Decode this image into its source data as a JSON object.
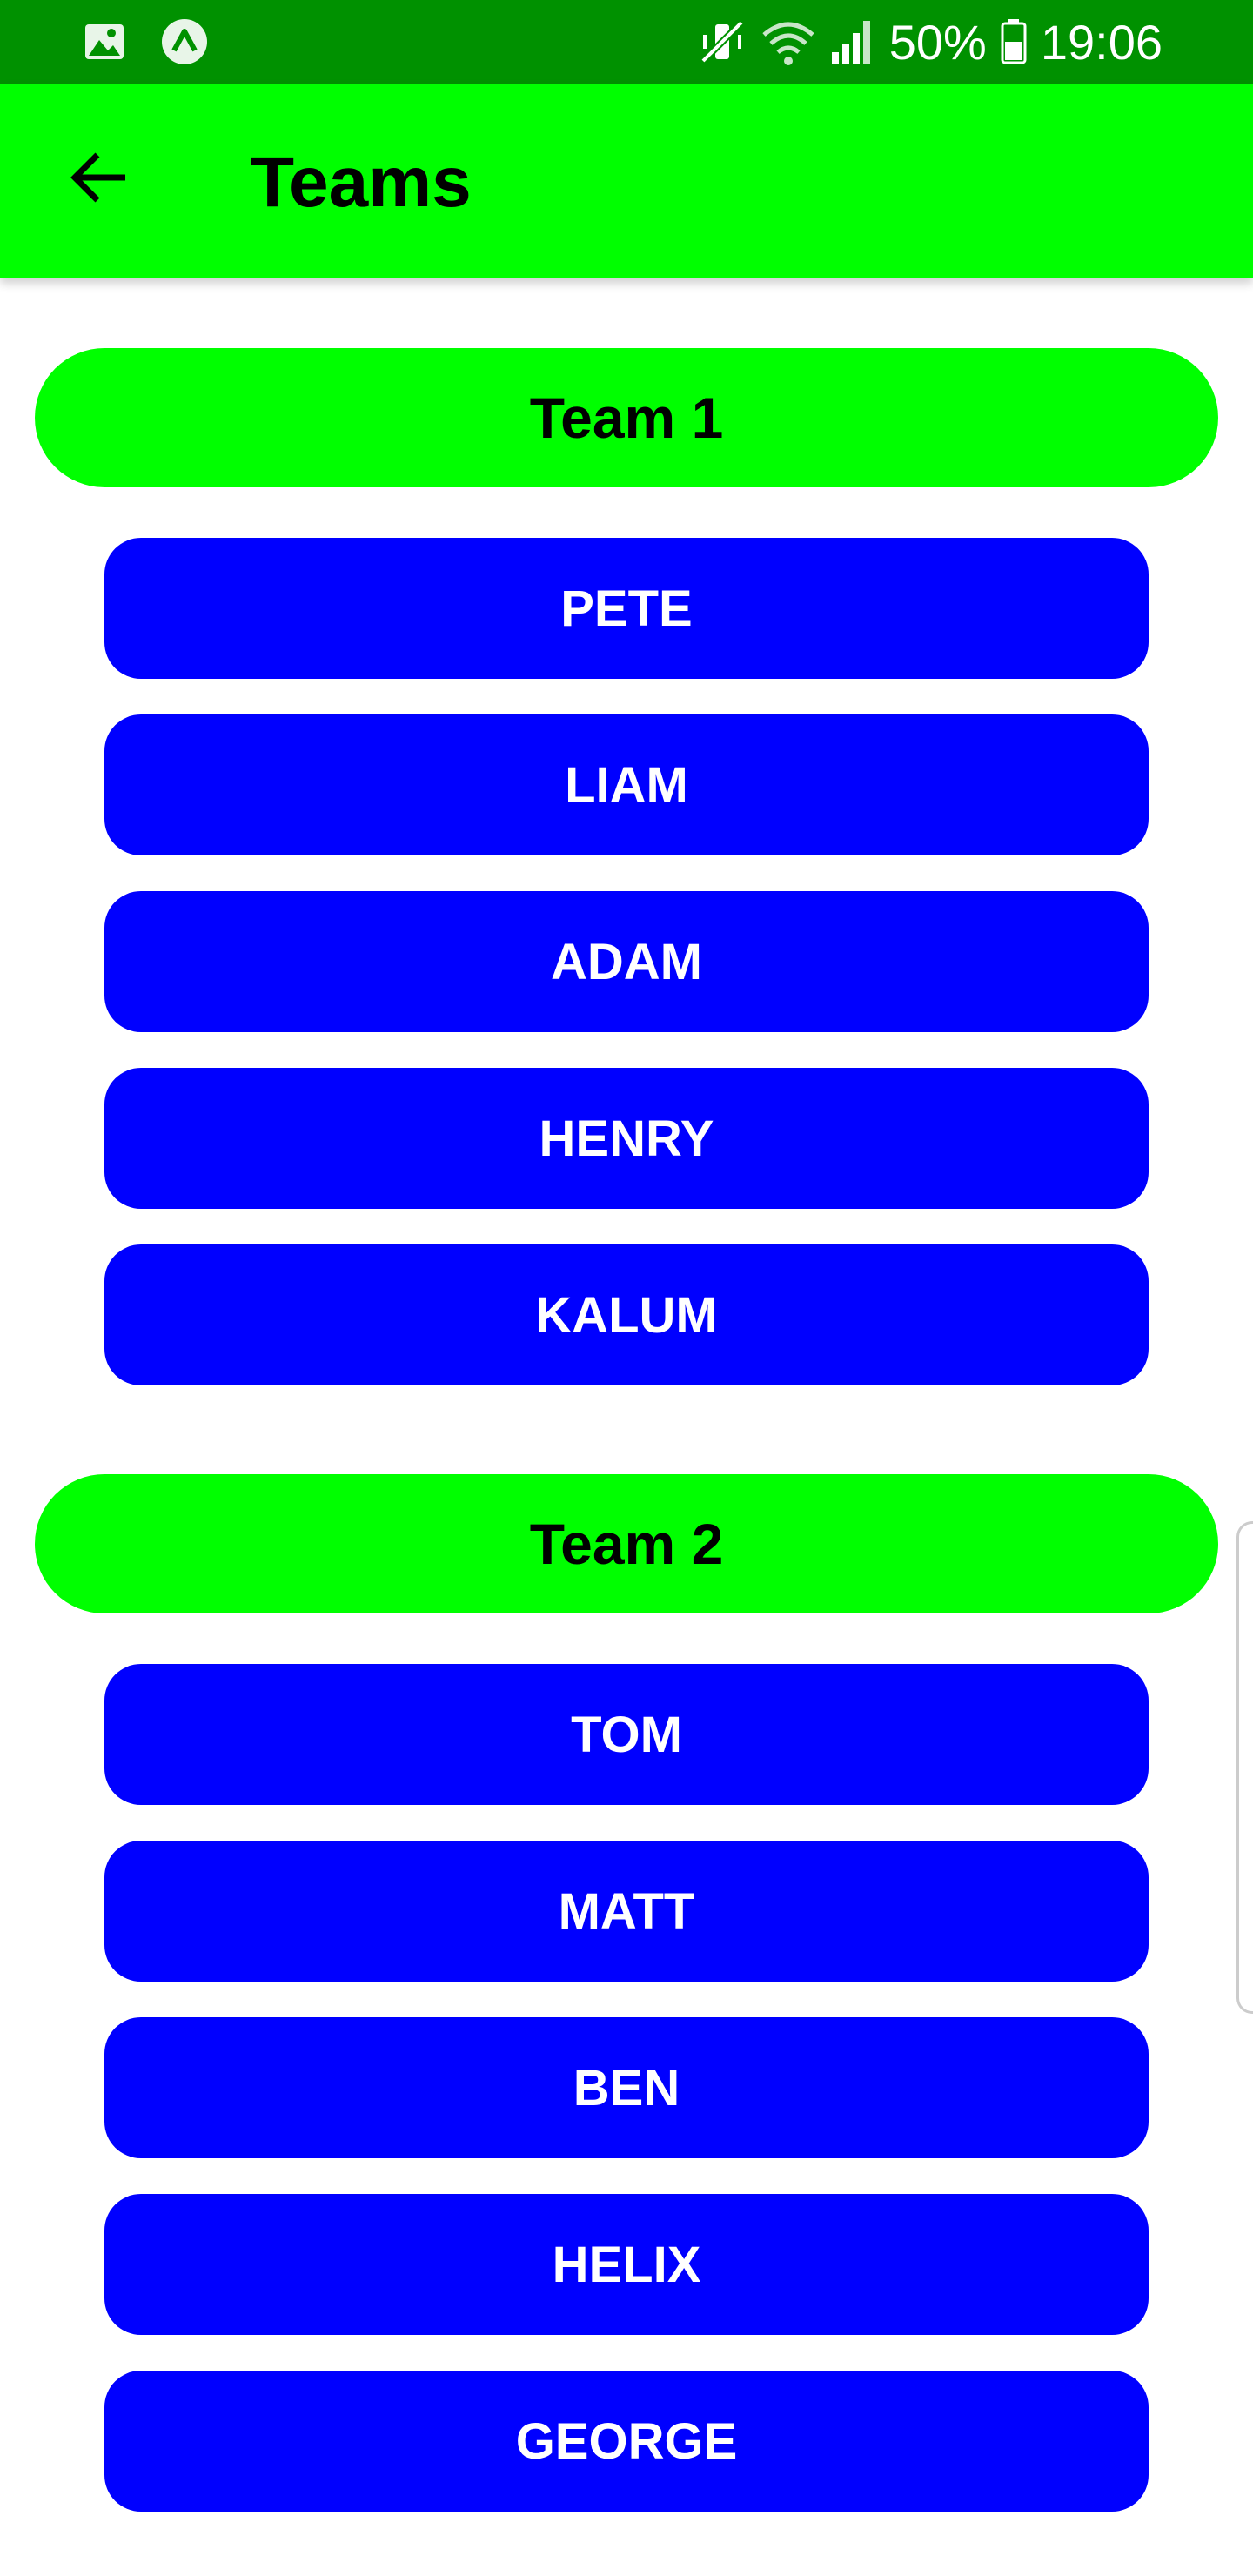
{
  "status_bar": {
    "battery": "50%",
    "time": "19:06",
    "icons": [
      "gallery-icon",
      "app-notification-icon",
      "mute-icon",
      "wifi-icon",
      "signal-icon",
      "battery-icon"
    ]
  },
  "app_bar": {
    "title": "Teams",
    "back_icon": "arrow-back-icon"
  },
  "teams": [
    {
      "name": "Team 1",
      "players": [
        "PETE",
        "LIAM",
        "ADAM",
        "HENRY",
        "KALUM"
      ]
    },
    {
      "name": "Team 2",
      "players": [
        "TOM",
        "MATT",
        "BEN",
        "HELIX",
        "GEORGE"
      ]
    }
  ],
  "colors": {
    "status_bar": "#009100",
    "accent": "#00ff00",
    "player_button": "#0000ff",
    "player_text": "#ffffff"
  }
}
